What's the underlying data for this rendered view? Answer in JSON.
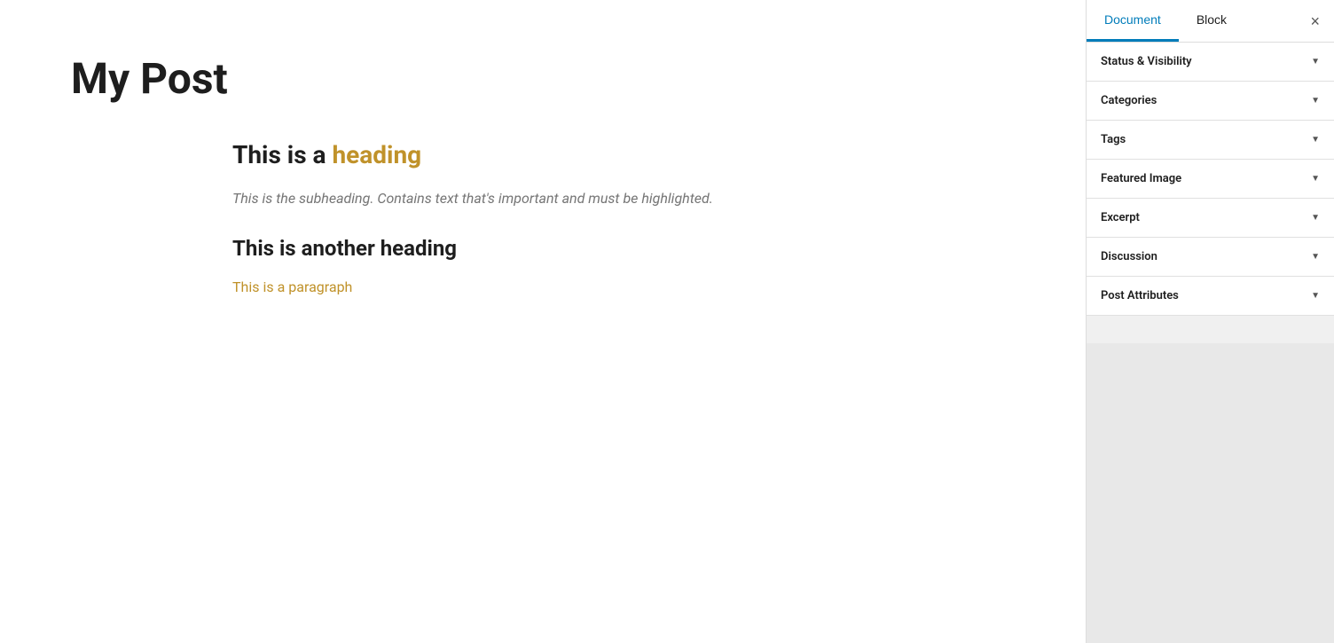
{
  "editor": {
    "post_title": "My Post",
    "content": {
      "heading1_prefix": "This is a ",
      "heading1_highlight": "heading",
      "subheading": "This is the subheading. Contains text that's important and must be highlighted.",
      "heading2": "This is another heading",
      "paragraph_link": "This is a paragraph"
    }
  },
  "sidebar": {
    "tab_document": "Document",
    "tab_block": "Block",
    "close_label": "×",
    "panels": [
      {
        "id": "status-visibility",
        "label": "Status & Visibility"
      },
      {
        "id": "categories",
        "label": "Categories"
      },
      {
        "id": "tags",
        "label": "Tags"
      },
      {
        "id": "featured-image",
        "label": "Featured Image"
      },
      {
        "id": "excerpt",
        "label": "Excerpt"
      },
      {
        "id": "discussion",
        "label": "Discussion"
      },
      {
        "id": "post-attributes",
        "label": "Post Attributes"
      }
    ]
  }
}
